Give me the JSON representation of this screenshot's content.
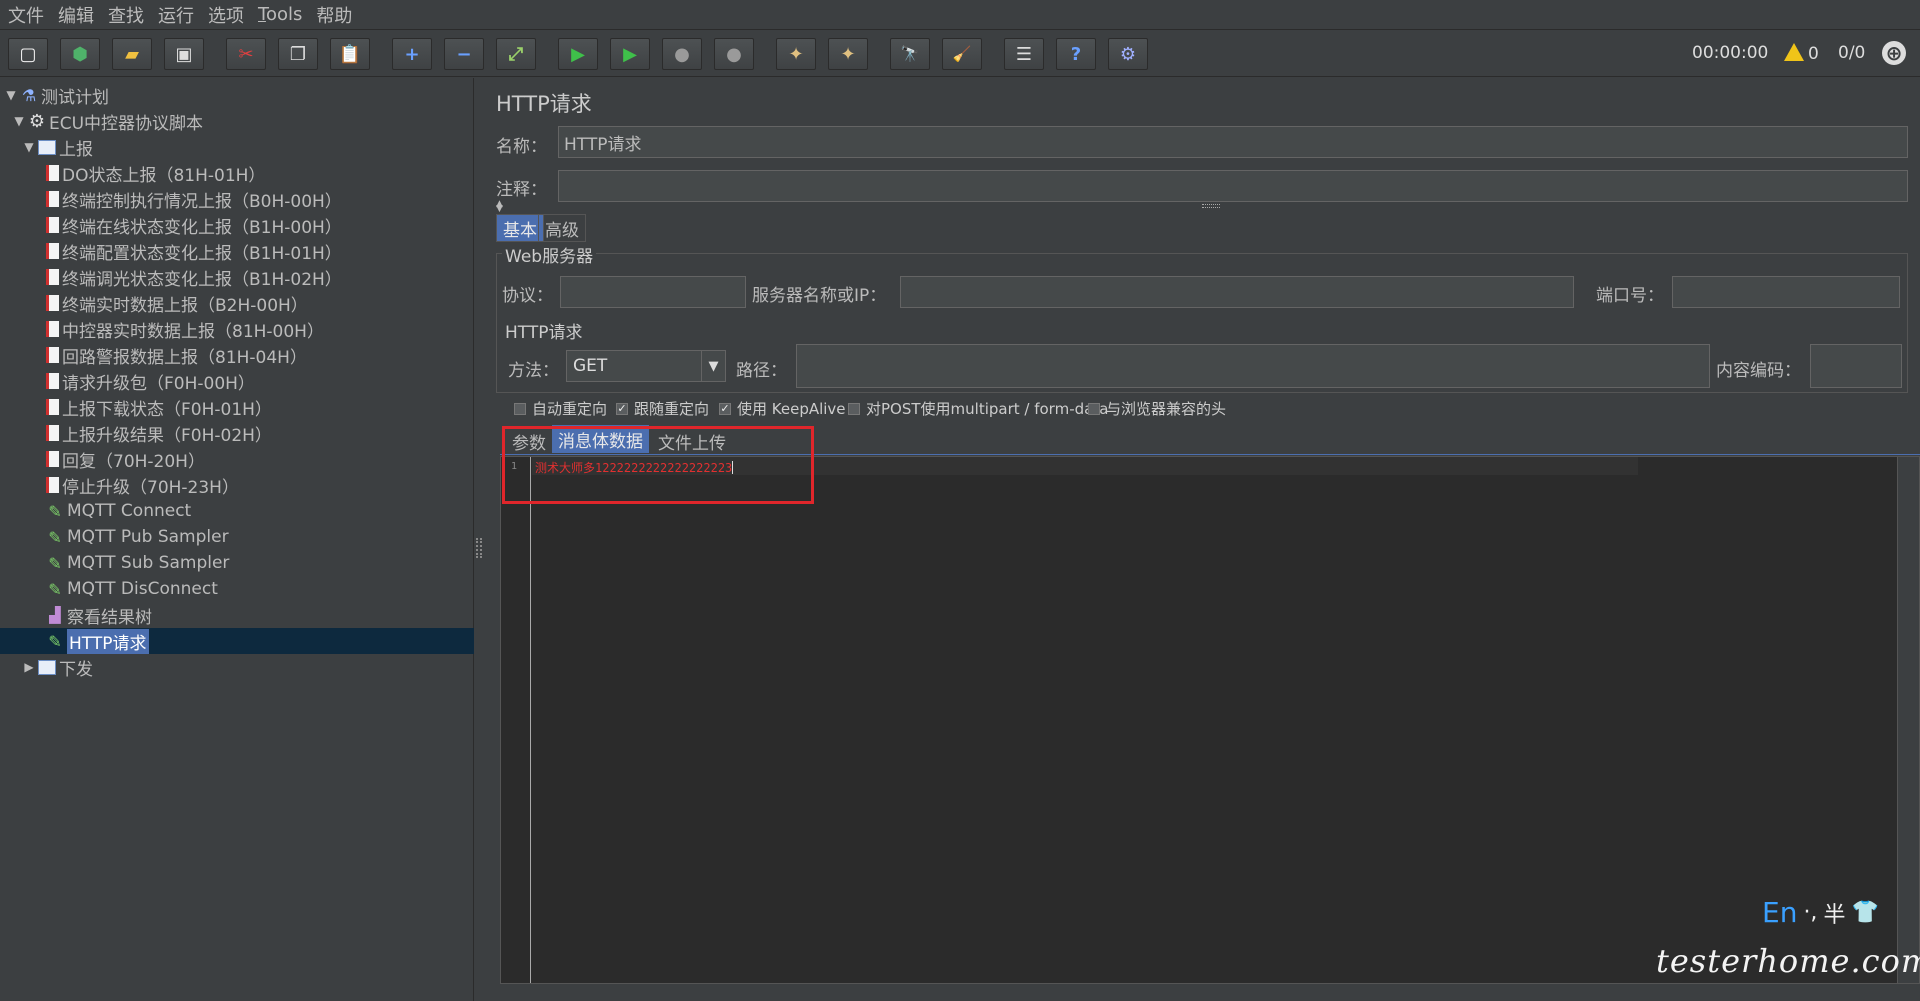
{
  "menu": [
    "文件",
    "编辑",
    "查找",
    "运行",
    "选项",
    "Tools",
    "帮助"
  ],
  "toolbar": {
    "timer": "00:00:00",
    "warn_count": "0",
    "threads": "0/0",
    "icons": [
      "new-icon",
      "templates-icon",
      "open-icon",
      "save-icon",
      "cut-icon",
      "copy-icon",
      "paste-icon",
      "expand-icon",
      "collapse-icon",
      "toggle-icon",
      "start-icon",
      "start-no-pause-icon",
      "stop-icon",
      "shutdown-icon",
      "clear-icon",
      "clear-all-icon",
      "search-icon",
      "reset-search-icon",
      "function-helper-icon",
      "help-icon",
      "remote-icon"
    ],
    "glyphs": [
      "▢",
      "⬢",
      "▰",
      "▣",
      "✂",
      "❐",
      "📋",
      "+",
      "−",
      "⤢",
      "▶",
      "▶",
      "●",
      "●",
      "✦",
      "✦",
      "🔭",
      "🧹",
      "☰",
      "?",
      "⚙"
    ]
  },
  "tree": {
    "items": [
      {
        "label": "测试计划",
        "icon": "flask-icon",
        "toggle": "▼"
      },
      {
        "label": "ECU中控器协议脚本",
        "icon": "gear-icon",
        "toggle": "▼"
      },
      {
        "label": "上报",
        "icon": "folder-icon",
        "toggle": "▼"
      },
      {
        "label": "DO状态上报（81H-01H）",
        "icon": "sampler-icon",
        "toggle": ""
      },
      {
        "label": "终端控制执行情况上报（B0H-00H）",
        "icon": "sampler-icon",
        "toggle": ""
      },
      {
        "label": "终端在线状态变化上报（B1H-00H）",
        "icon": "sampler-icon",
        "toggle": ""
      },
      {
        "label": "终端配置状态变化上报（B1H-01H）",
        "icon": "sampler-icon",
        "toggle": ""
      },
      {
        "label": "终端调光状态变化上报（B1H-02H）",
        "icon": "sampler-icon",
        "toggle": ""
      },
      {
        "label": "终端实时数据上报（B2H-00H）",
        "icon": "sampler-icon",
        "toggle": ""
      },
      {
        "label": "中控器实时数据上报（81H-00H）",
        "icon": "sampler-icon",
        "toggle": ""
      },
      {
        "label": "回路警报数据上报（81H-04H）",
        "icon": "sampler-icon",
        "toggle": ""
      },
      {
        "label": "请求升级包（F0H-00H）",
        "icon": "sampler-icon",
        "toggle": ""
      },
      {
        "label": "上报下载状态（F0H-01H）",
        "icon": "sampler-icon",
        "toggle": ""
      },
      {
        "label": "上报升级结果（F0H-02H）",
        "icon": "sampler-icon",
        "toggle": ""
      },
      {
        "label": "回复（70H-20H）",
        "icon": "sampler-icon",
        "toggle": ""
      },
      {
        "label": "停止升级（70H-23H）",
        "icon": "sampler-icon",
        "toggle": ""
      },
      {
        "label": "MQTT Connect",
        "icon": "pen-icon",
        "toggle": ""
      },
      {
        "label": "MQTT Pub Sampler",
        "icon": "pen-icon",
        "toggle": ""
      },
      {
        "label": "MQTT Sub Sampler",
        "icon": "pen-icon",
        "toggle": ""
      },
      {
        "label": "MQTT DisConnect",
        "icon": "pen-icon",
        "toggle": ""
      },
      {
        "label": "察看结果树",
        "icon": "chart-icon",
        "toggle": ""
      },
      {
        "label": "HTTP请求",
        "icon": "pen-icon",
        "toggle": "",
        "selected": true
      },
      {
        "label": "下发",
        "icon": "folder-icon",
        "toggle": "▶"
      }
    ]
  },
  "panel": {
    "title": "HTTP请求",
    "name_label": "名称：",
    "name_value": "HTTP请求",
    "comment_label": "注释：",
    "comment_value": "",
    "tabs": [
      "基本",
      "高级"
    ],
    "web_server": {
      "title": "Web服务器",
      "protocol_label": "协议：",
      "protocol_value": "",
      "server_label": "服务器名称或IP：",
      "server_value": "",
      "port_label": "端口号：",
      "port_value": ""
    },
    "http": {
      "title": "HTTP请求",
      "method_label": "方法：",
      "method_value": "GET",
      "path_label": "路径：",
      "path_value": "",
      "encoding_label": "内容编码：",
      "encoding_value": ""
    },
    "checkboxes": [
      {
        "label": "自动重定向",
        "checked": false
      },
      {
        "label": "跟随重定向",
        "checked": true
      },
      {
        "label": "使用 KeepAlive",
        "checked": true
      },
      {
        "label": "对POST使用multipart / form-data",
        "checked": false
      },
      {
        "label": "与浏览器兼容的头",
        "checked": false
      }
    ],
    "subtabs": [
      "参数",
      "消息体数据",
      "文件上传"
    ],
    "editor": {
      "line_number": "1",
      "content": "测术大师多1222222222222222223"
    }
  },
  "ime": {
    "lang": "En",
    "punct": "·,",
    "width": "半",
    "skin": "👕"
  },
  "watermark": "testerhome.com",
  "colors": {
    "accent": "#4b6eaf",
    "highlight": "#e0262b",
    "editor_text": "#e03030"
  }
}
